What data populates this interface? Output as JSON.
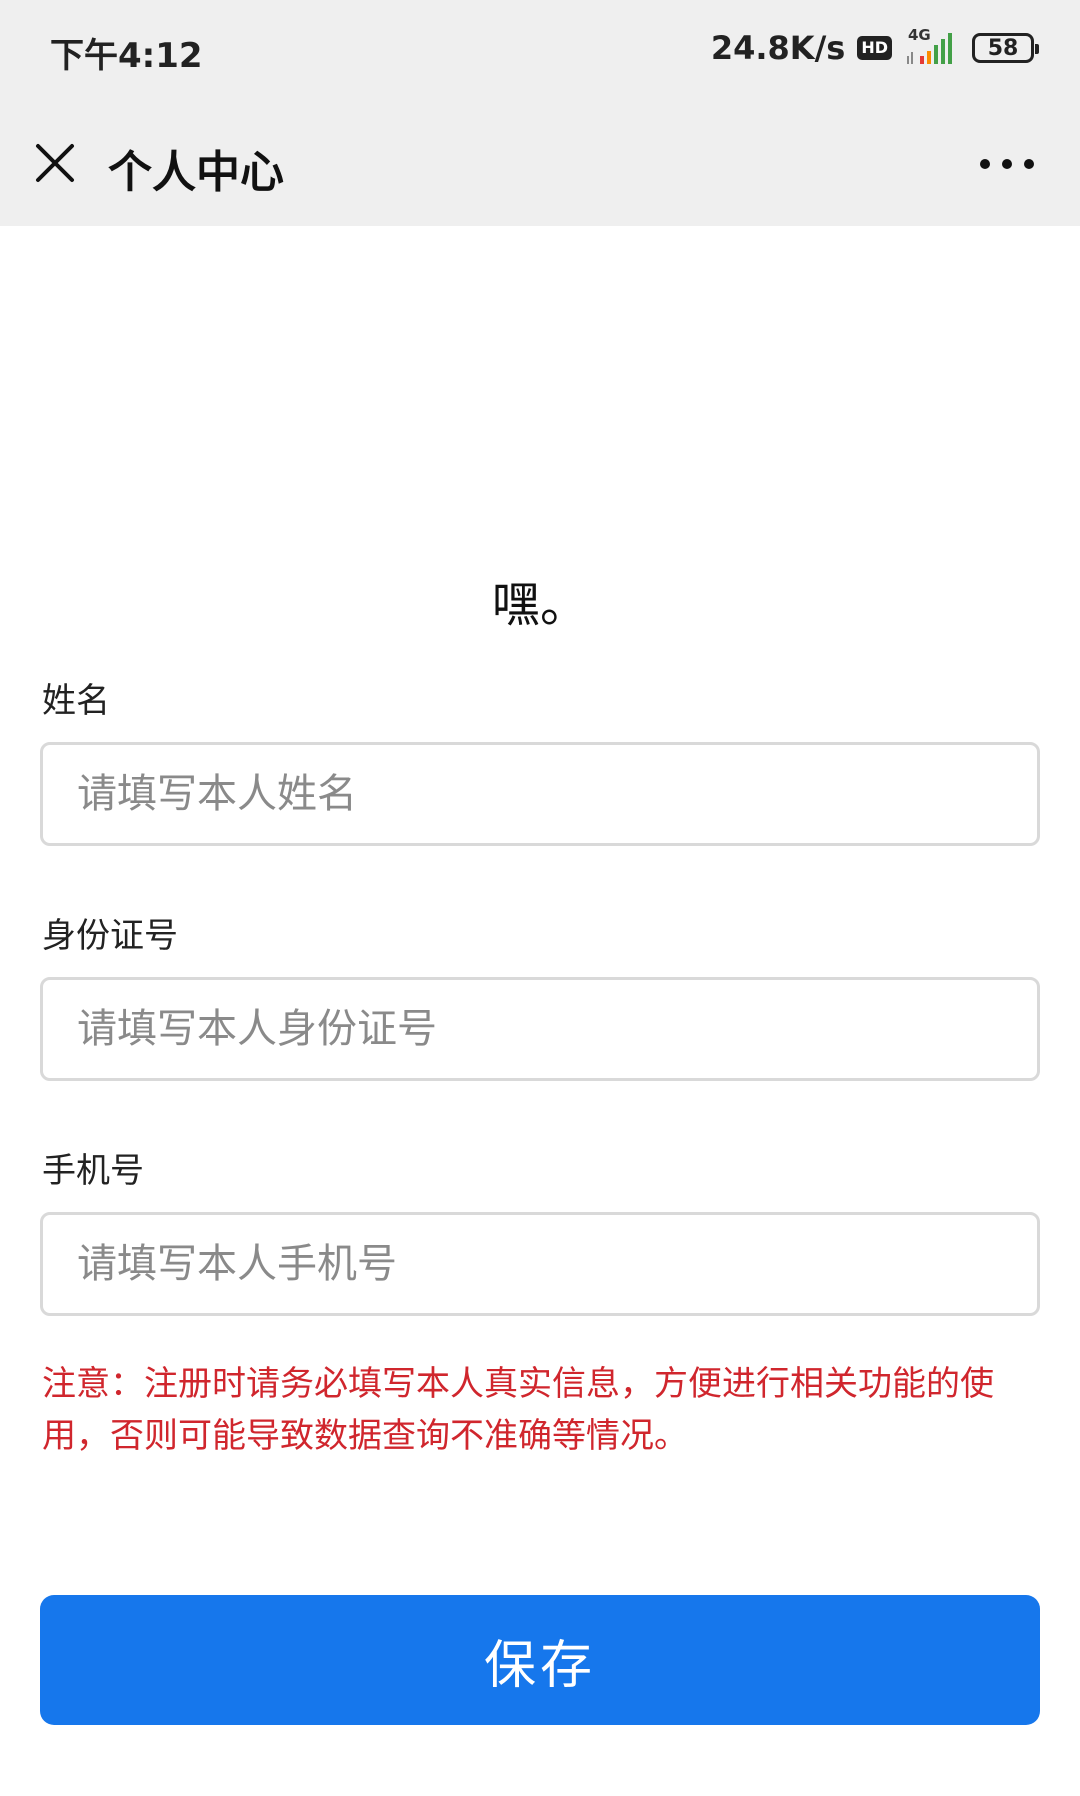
{
  "status_bar": {
    "time": "下午4:12",
    "net_speed": "24.8K/s",
    "hd_label": "HD",
    "network_label": "4G",
    "battery_level": "58"
  },
  "nav": {
    "title": "个人中心",
    "close_icon": "close-icon",
    "more_icon": "more-icon"
  },
  "content": {
    "heading": "嘿。"
  },
  "form": {
    "name_label": "姓名",
    "name_placeholder": "请填写本人姓名",
    "id_label": "身份证号",
    "id_placeholder": "请填写本人身份证号",
    "phone_label": "手机号",
    "phone_placeholder": "请填写本人手机号"
  },
  "notice": "注意：注册时请务必填写本人真实信息，方便进行相关功能的使用，否则可能导致数据查询不准确等情况。",
  "save_label": "保存",
  "colors": {
    "primary": "#1677ec",
    "notice": "#d0262d",
    "header_bg": "#efefef"
  }
}
